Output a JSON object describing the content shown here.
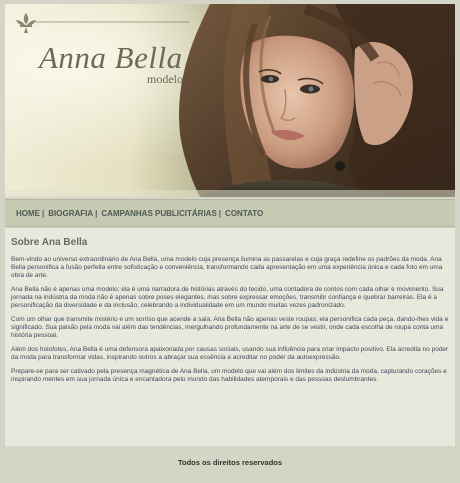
{
  "brand": {
    "name": "Anna Bella",
    "subtitle": "modelo"
  },
  "nav": {
    "items": [
      {
        "label": "HOME"
      },
      {
        "label": "BIOGRAFIA"
      },
      {
        "label": "CAMPANHAS PUBLICITÁRIAS"
      },
      {
        "label": "CONTATO"
      }
    ],
    "separator": "|"
  },
  "main": {
    "title": "Sobre Ana Bella",
    "paragraphs": [
      "Bem-vindo ao universo extraordinário de Ana Bella, uma modelo cuja presença ilumina as passarelas e cuja graça redefine os padrões da moda. Ana Bella personifica a fusão perfeita entre sofisticação e conveniência, transformando cada apresentação em uma experiência única e cada foto em uma obra de arte.",
      "Ana Bella não é apenas uma modelo; ela é uma narradora de histórias através do tecido, uma contadora de contos com cada olhar e movimento. Sua jornada na indústria da moda não é apenas sobre poses elegantes, mas sobre expressar emoções, transmitir confiança e quebrar barreiras. Ela é a personificação da diversidade e da inclusão, celebrando a individualidade em um mundo muitas vezes padronizado.",
      "Com um olhar que transmite mistério e um sorriso que acende a sala, Ana Bella não apenas veste roupas; ela personifica cada peça, dando-lhes vida e significado. Sua paixão pela moda vai além das tendências, mergulhando profundamente na arte de se vestir, onde cada escolha de roupa conta uma história pessoal.",
      "Além dos holofotes, Ana Bella é uma defensora apaixonada por causas sociais, usando sua influência para criar impacto positivo. Ela acredita no poder da moda para transformar vidas, inspirando outros a abraçar sua essência e acreditar no poder da autoexpressão.",
      "Prepare-se para ser cativado pela presença magnética de Ana Bella, um modelo que vai além dos limites da indústria da moda, capturando corações e inspirando mentes em sua jornada única e encantadora pelo mundo das habilidades atemporais e das pessoas deslumbrantes."
    ]
  },
  "footer": {
    "text": "Todos os direitos reservados"
  },
  "colors": {
    "page_bg": "#d4d5c6",
    "nav_bg": "#c8c9b3",
    "content_bg": "#e8e9dc",
    "nav_text": "#4c5a55",
    "body_text": "#3f4a5b",
    "heading_text": "#6a6a5c",
    "brand_text": "#6f6a55"
  },
  "icons": {
    "header_ornament": "fleur-de-lis-icon"
  }
}
